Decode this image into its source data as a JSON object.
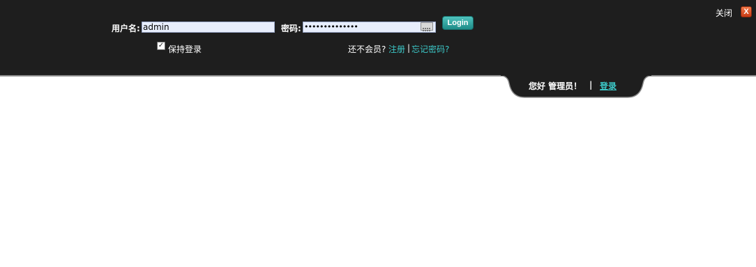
{
  "top_panel": {
    "close_label": "关闭",
    "close_icon_glyph": "X",
    "username_label": "用户名:",
    "username_value": "admin",
    "password_label": "密码:",
    "password_value": "••••••••••••••",
    "login_button": "Login",
    "remember_label": "保持登录",
    "remember_checked": true,
    "not_member": "还不会员?",
    "register_link": "注册",
    "separator": "|",
    "forgot_link": "忘记密码?"
  },
  "tab": {
    "greeting": "您好 管理员！",
    "separator": "|",
    "login_link": "登录"
  },
  "colors": {
    "panel_bg": "#1e1e1e",
    "link": "#3cc8c8",
    "button": "#2aa5a1",
    "close": "#e05a2a"
  }
}
